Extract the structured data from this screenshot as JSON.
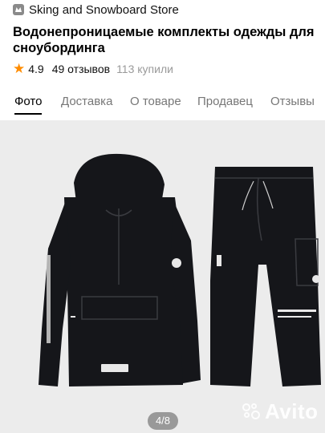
{
  "store": {
    "name": "Sking and Snowboard Store"
  },
  "product": {
    "title": "Водонепроницаемые комплекты одежды для сноубординга",
    "rating": "4.9",
    "reviews": "49 отзывов",
    "bought": "113 купили"
  },
  "tabs": [
    {
      "label": "Фото",
      "active": true
    },
    {
      "label": "Доставка",
      "active": false
    },
    {
      "label": "О товаре",
      "active": false
    },
    {
      "label": "Продавец",
      "active": false
    },
    {
      "label": "Отзывы",
      "active": false
    }
  ],
  "gallery": {
    "counter": "4/8",
    "watermark": "Avito"
  },
  "colors": {
    "accent_star": "#ff8c00",
    "photo_bg": "#ececec",
    "garment": "#15161a"
  },
  "icons": [
    "store-logo-icon",
    "star-icon",
    "avito-logo-icon"
  ]
}
